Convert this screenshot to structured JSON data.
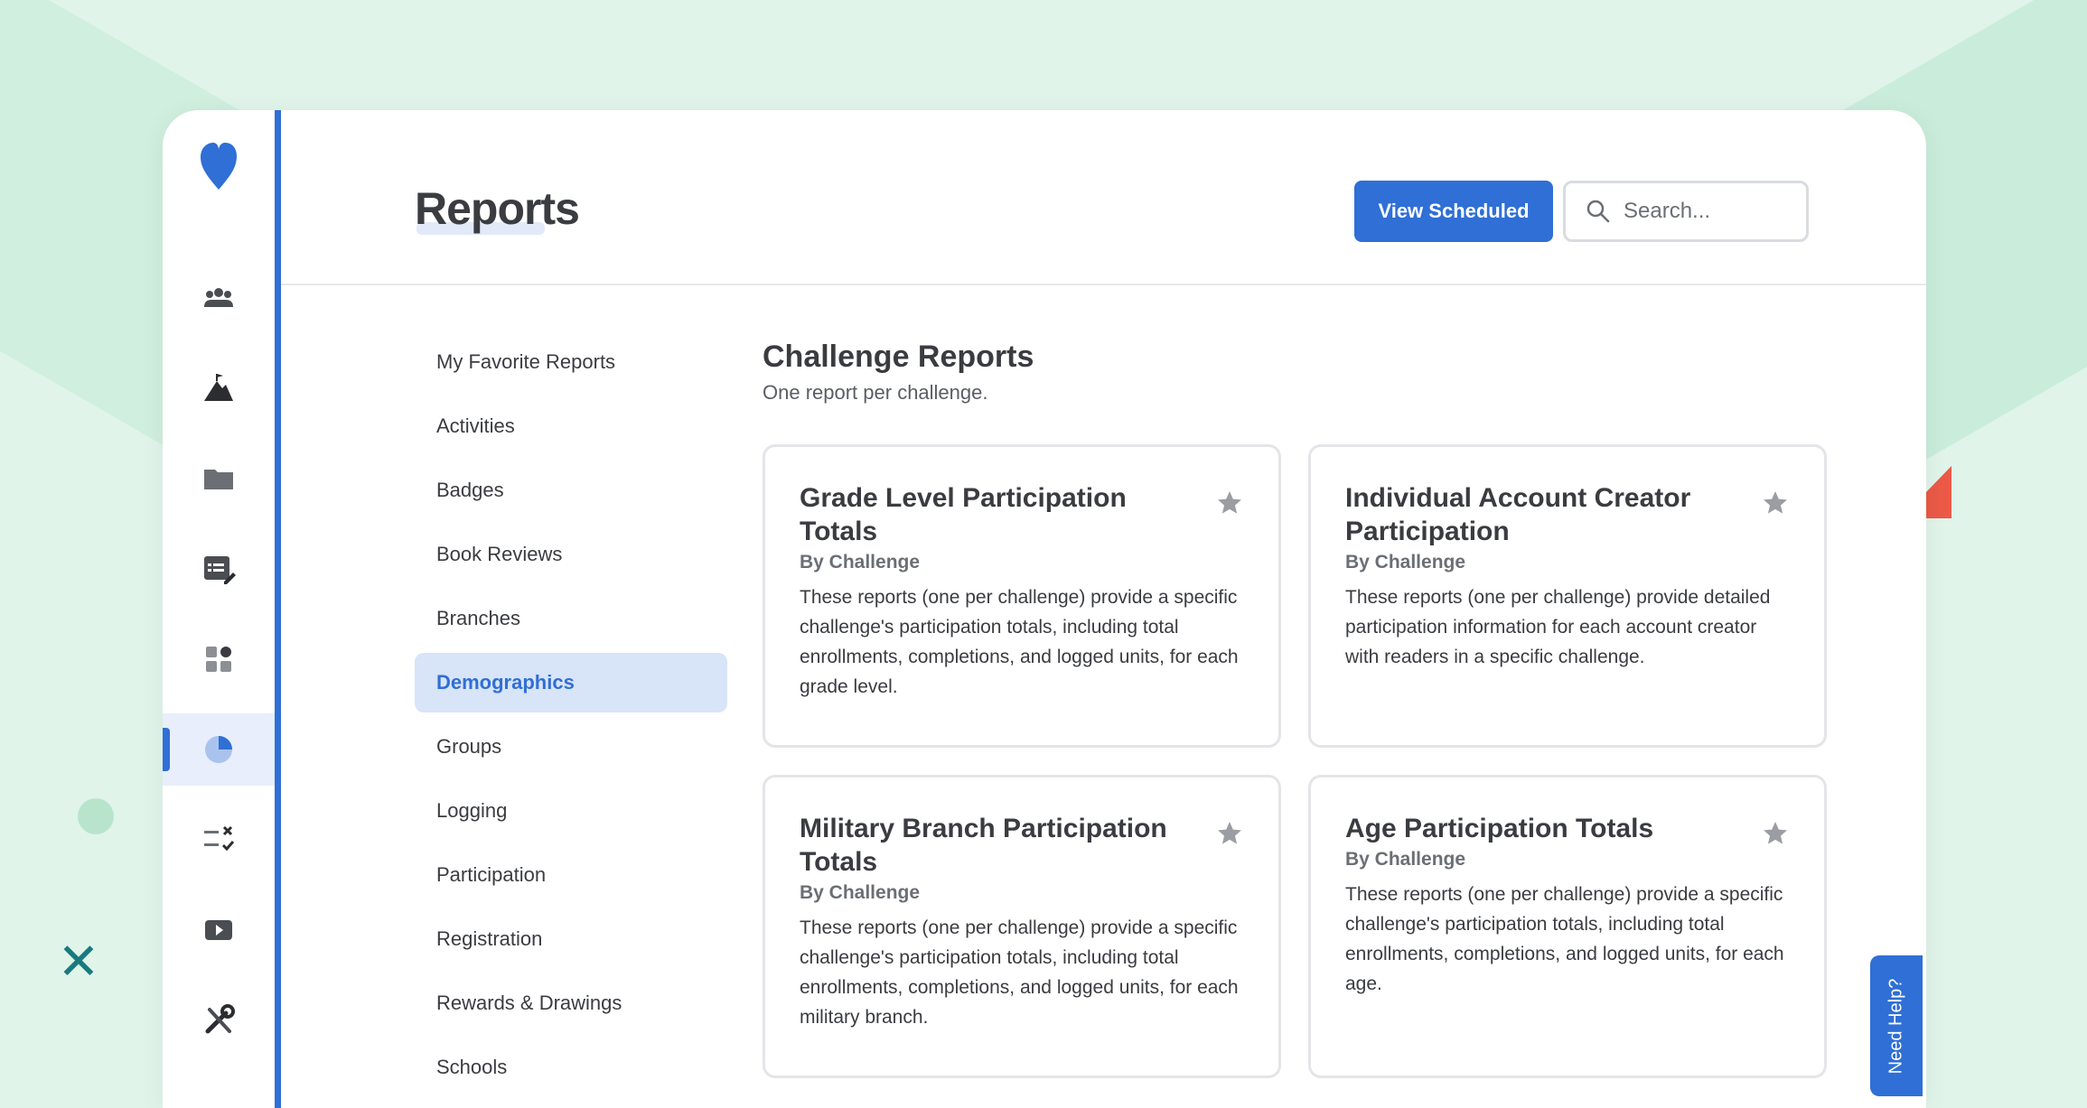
{
  "header": {
    "title": "Reports",
    "view_scheduled_label": "View Scheduled",
    "search_placeholder": "Search..."
  },
  "rail": {
    "items": [
      {
        "icon": "users-icon"
      },
      {
        "icon": "mountain-flag-icon"
      },
      {
        "icon": "folder-icon"
      },
      {
        "icon": "list-edit-icon"
      },
      {
        "icon": "widgets-icon"
      },
      {
        "icon": "pie-chart-icon",
        "active": true
      },
      {
        "icon": "checklist-icon"
      },
      {
        "icon": "video-icon"
      },
      {
        "icon": "tools-icon"
      }
    ],
    "accent": "#2f6fd6"
  },
  "categories": [
    "My Favorite Reports",
    "Activities",
    "Badges",
    "Book Reviews",
    "Branches",
    "Demographics",
    "Groups",
    "Logging",
    "Participation",
    "Registration",
    "Rewards & Drawings",
    "Schools"
  ],
  "active_category": "Demographics",
  "section": {
    "title": "Challenge Reports",
    "subtitle": "One report per challenge."
  },
  "cards": [
    {
      "title": "Grade Level Participation Totals",
      "by": "By Challenge",
      "description": "These reports (one per challenge) provide a specific challenge's participation totals, including total enrollments, completions, and logged units, for each grade level."
    },
    {
      "title": "Individual Account Creator Participation",
      "by": "By Challenge",
      "description": "These reports (one per challenge) provide detailed participation information for each account creator with readers in a specific challenge."
    },
    {
      "title": "Military Branch Participation Totals",
      "by": "By Challenge",
      "description": "These reports (one per challenge) provide a specific challenge's participation totals, including total enrollments, completions, and logged units, for each military branch."
    },
    {
      "title": "Age Participation Totals",
      "by": "By Challenge",
      "description": "These reports (one per challenge) provide a specific challenge's participation totals, including total enrollments, completions, and logged units, for each age."
    }
  ],
  "need_help_label": "Need Help?"
}
